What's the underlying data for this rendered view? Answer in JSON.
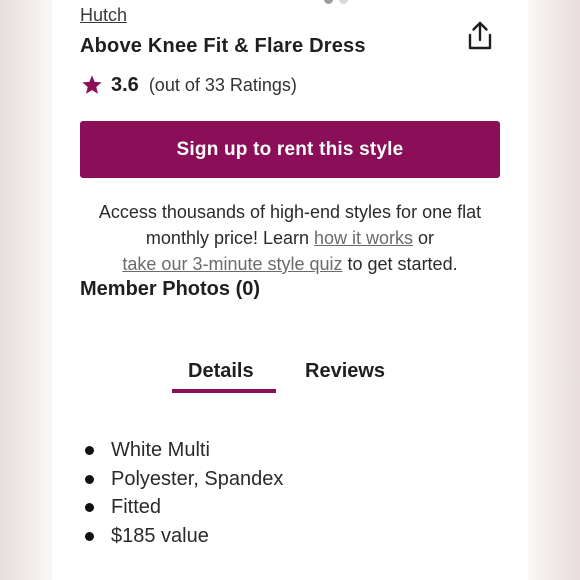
{
  "product": {
    "brand": "Hutch",
    "title": "Above Knee Fit & Flare Dress"
  },
  "rating": {
    "value": "3.6",
    "count_text": "(out of 33 Ratings)",
    "icon": "star-icon"
  },
  "share": {
    "icon": "share-icon"
  },
  "cta": {
    "label": "Sign up to rent this style"
  },
  "promo": {
    "text1": "Access thousands of high-end styles for one flat monthly price! Learn ",
    "link1": "how it works",
    "text2": " or ",
    "link2": "take our 3-minute style quiz",
    "text3": " to get started."
  },
  "member_photos": {
    "label": "Member Photos (0)"
  },
  "tabs": [
    {
      "label": "Details",
      "active": true
    },
    {
      "label": "Reviews",
      "active": false
    }
  ],
  "details": [
    "White Multi",
    "Polyester, Spandex",
    "Fitted",
    "$185 value"
  ],
  "colors": {
    "accent": "#8a0f58",
    "text": "#1f1f1f",
    "link": "#6b6b6b"
  }
}
